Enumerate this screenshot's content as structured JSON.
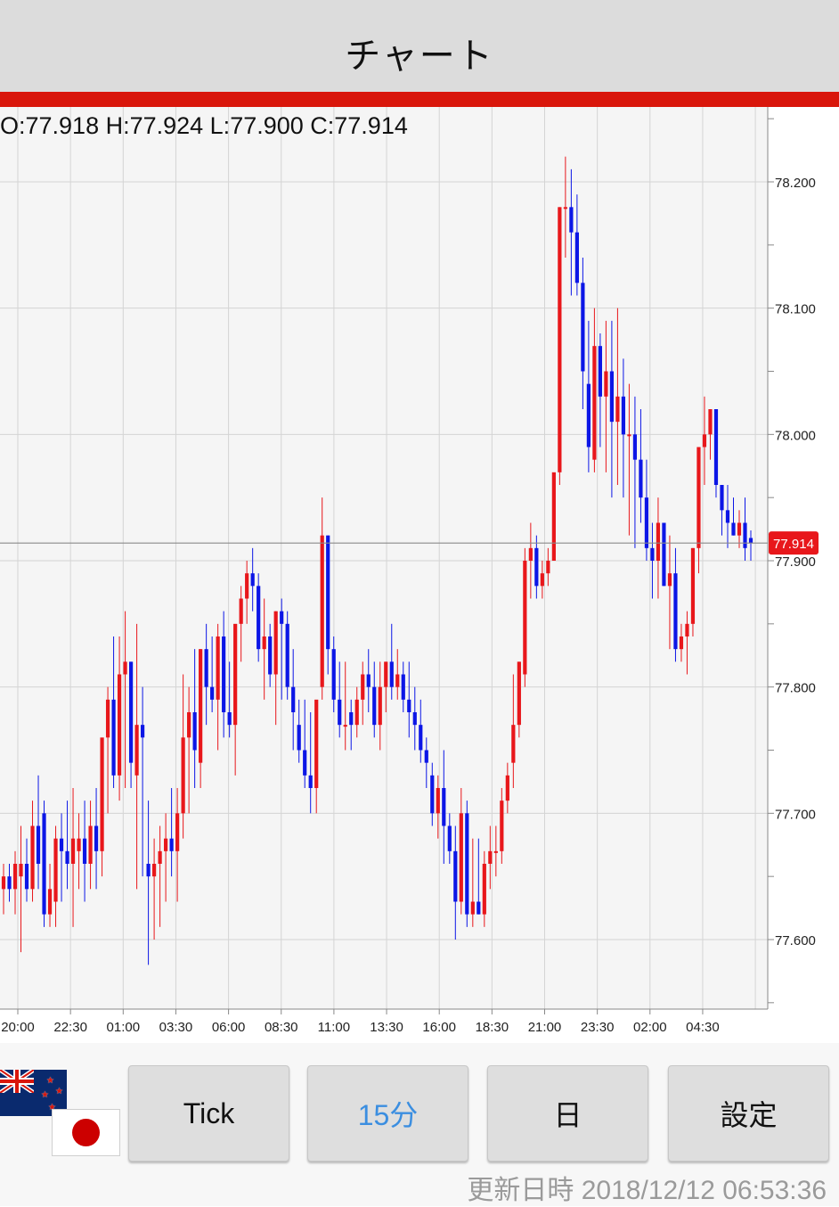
{
  "header": {
    "title": "チャート"
  },
  "ohlc": {
    "text": "O:77.918 H:77.924 L:77.900 C:77.914"
  },
  "chart_data": {
    "type": "candlestick",
    "y_axis_labels": [
      "78.200",
      "78.100",
      "78.000",
      "77.900",
      "77.800",
      "77.700",
      "77.600"
    ],
    "y_axis_values": [
      78.2,
      78.1,
      78.0,
      77.9,
      77.8,
      77.7,
      77.6
    ],
    "x_axis_labels": [
      "20:00",
      "22:30",
      "01:00",
      "03:30",
      "06:00",
      "08:30",
      "11:00",
      "13:30",
      "16:00",
      "18:30",
      "21:00",
      "23:30",
      "02:00",
      "04:30"
    ],
    "ylim": [
      77.54,
      78.25
    ],
    "current_price": 77.914,
    "current_price_label": "77.914",
    "up_color": "#e8171b",
    "down_color": "#0c16e6",
    "grid": true,
    "candles": [
      [
        77.64,
        77.66,
        77.62,
        77.65
      ],
      [
        77.65,
        77.66,
        77.63,
        77.64
      ],
      [
        77.64,
        77.67,
        77.62,
        77.66
      ],
      [
        77.65,
        77.69,
        77.59,
        77.66
      ],
      [
        77.66,
        77.68,
        77.63,
        77.64
      ],
      [
        77.64,
        77.71,
        77.63,
        77.69
      ],
      [
        77.69,
        77.73,
        77.64,
        77.66
      ],
      [
        77.7,
        77.71,
        77.61,
        77.62
      ],
      [
        77.62,
        77.66,
        77.61,
        77.64
      ],
      [
        77.63,
        77.69,
        77.61,
        77.68
      ],
      [
        77.68,
        77.7,
        77.63,
        77.67
      ],
      [
        77.67,
        77.71,
        77.64,
        77.66
      ],
      [
        77.66,
        77.72,
        77.61,
        77.68
      ],
      [
        77.67,
        77.7,
        77.64,
        77.68
      ],
      [
        77.68,
        77.71,
        77.63,
        77.66
      ],
      [
        77.66,
        77.71,
        77.64,
        77.69
      ],
      [
        77.69,
        77.72,
        77.64,
        77.67
      ],
      [
        77.67,
        77.75,
        77.65,
        77.76
      ],
      [
        77.76,
        77.8,
        77.7,
        77.79
      ],
      [
        77.79,
        77.84,
        77.72,
        77.73
      ],
      [
        77.73,
        77.84,
        77.71,
        77.81
      ],
      [
        77.81,
        77.86,
        77.72,
        77.82
      ],
      [
        77.82,
        77.82,
        77.72,
        77.74
      ],
      [
        77.73,
        77.85,
        77.64,
        77.77
      ],
      [
        77.77,
        77.8,
        77.65,
        77.76
      ],
      [
        77.66,
        77.71,
        77.58,
        77.65
      ],
      [
        77.65,
        77.68,
        77.6,
        77.66
      ],
      [
        77.66,
        77.69,
        77.61,
        77.67
      ],
      [
        77.67,
        77.7,
        77.63,
        77.68
      ],
      [
        77.68,
        77.72,
        77.65,
        77.67
      ],
      [
        77.67,
        77.72,
        77.63,
        77.7
      ],
      [
        77.7,
        77.81,
        77.68,
        77.76
      ],
      [
        77.76,
        77.8,
        77.7,
        77.78
      ],
      [
        77.78,
        77.83,
        77.72,
        77.75
      ],
      [
        77.74,
        77.83,
        77.72,
        77.83
      ],
      [
        77.83,
        77.85,
        77.77,
        77.8
      ],
      [
        77.8,
        77.84,
        77.78,
        77.79
      ],
      [
        77.79,
        77.85,
        77.75,
        77.84
      ],
      [
        77.84,
        77.86,
        77.76,
        77.78
      ],
      [
        77.78,
        77.82,
        77.76,
        77.77
      ],
      [
        77.77,
        77.84,
        77.73,
        77.85
      ],
      [
        77.85,
        77.88,
        77.82,
        77.87
      ],
      [
        77.87,
        77.9,
        77.85,
        77.89
      ],
      [
        77.89,
        77.91,
        77.86,
        77.88
      ],
      [
        77.88,
        77.89,
        77.82,
        77.83
      ],
      [
        77.83,
        77.87,
        77.79,
        77.84
      ],
      [
        77.84,
        77.85,
        77.8,
        77.81
      ],
      [
        77.81,
        77.86,
        77.77,
        77.86
      ],
      [
        77.86,
        77.87,
        77.79,
        77.85
      ],
      [
        77.85,
        77.86,
        77.79,
        77.8
      ],
      [
        77.8,
        77.83,
        77.75,
        77.78
      ],
      [
        77.77,
        77.79,
        77.74,
        77.75
      ],
      [
        77.75,
        77.79,
        77.72,
        77.73
      ],
      [
        77.73,
        77.78,
        77.7,
        77.72
      ],
      [
        77.72,
        77.76,
        77.7,
        77.79
      ],
      [
        77.8,
        77.95,
        77.79,
        77.92
      ],
      [
        77.92,
        77.92,
        77.81,
        77.83
      ],
      [
        77.83,
        77.84,
        77.78,
        77.79
      ],
      [
        77.79,
        77.82,
        77.76,
        77.77
      ],
      [
        77.77,
        77.82,
        77.75,
        77.77
      ],
      [
        77.78,
        77.79,
        77.75,
        77.77
      ],
      [
        77.77,
        77.8,
        77.76,
        77.79
      ],
      [
        77.79,
        77.82,
        77.77,
        77.81
      ],
      [
        77.81,
        77.83,
        77.78,
        77.8
      ],
      [
        77.8,
        77.82,
        77.76,
        77.77
      ],
      [
        77.77,
        77.82,
        77.75,
        77.8
      ],
      [
        77.8,
        77.82,
        77.78,
        77.82
      ],
      [
        77.82,
        77.85,
        77.79,
        77.8
      ],
      [
        77.8,
        77.83,
        77.79,
        77.81
      ],
      [
        77.81,
        77.82,
        77.78,
        77.79
      ],
      [
        77.79,
        77.82,
        77.76,
        77.78
      ],
      [
        77.78,
        77.8,
        77.75,
        77.77
      ],
      [
        77.77,
        77.79,
        77.74,
        77.75
      ],
      [
        77.75,
        77.76,
        77.72,
        77.74
      ],
      [
        77.73,
        77.74,
        77.69,
        77.7
      ],
      [
        77.7,
        77.73,
        77.68,
        77.72
      ],
      [
        77.72,
        77.75,
        77.66,
        77.69
      ],
      [
        77.69,
        77.7,
        77.66,
        77.67
      ],
      [
        77.67,
        77.69,
        77.6,
        77.63
      ],
      [
        77.63,
        77.72,
        77.62,
        77.7
      ],
      [
        77.7,
        77.71,
        77.61,
        77.62
      ],
      [
        77.62,
        77.68,
        77.61,
        77.63
      ],
      [
        77.63,
        77.68,
        77.62,
        77.62
      ],
      [
        77.62,
        77.67,
        77.61,
        77.66
      ],
      [
        77.66,
        77.69,
        77.64,
        77.67
      ],
      [
        77.67,
        77.69,
        77.65,
        77.67
      ],
      [
        77.67,
        77.72,
        77.66,
        77.71
      ],
      [
        77.71,
        77.74,
        77.7,
        77.73
      ],
      [
        77.74,
        77.81,
        77.72,
        77.77
      ],
      [
        77.77,
        77.82,
        77.76,
        77.82
      ],
      [
        77.81,
        77.91,
        77.8,
        77.9
      ],
      [
        77.9,
        77.93,
        77.87,
        77.91
      ],
      [
        77.91,
        77.92,
        77.87,
        77.88
      ],
      [
        77.88,
        77.9,
        77.87,
        77.89
      ],
      [
        77.89,
        77.91,
        77.88,
        77.9
      ],
      [
        77.9,
        77.95,
        77.9,
        77.97
      ],
      [
        77.97,
        78.18,
        77.96,
        78.18
      ],
      [
        78.18,
        78.22,
        78.14,
        78.18
      ],
      [
        78.18,
        78.21,
        78.11,
        78.16
      ],
      [
        78.16,
        78.19,
        78.11,
        78.12
      ],
      [
        78.12,
        78.14,
        78.02,
        78.05
      ],
      [
        78.04,
        78.09,
        77.97,
        77.99
      ],
      [
        77.98,
        78.1,
        77.97,
        78.07
      ],
      [
        78.07,
        78.08,
        77.99,
        78.03
      ],
      [
        78.03,
        78.09,
        77.97,
        78.05
      ],
      [
        78.05,
        78.09,
        77.95,
        78.01
      ],
      [
        78.01,
        78.1,
        77.96,
        78.03
      ],
      [
        78.03,
        78.06,
        77.95,
        78.0
      ],
      [
        78.0,
        78.04,
        77.92,
        78.0
      ],
      [
        78.0,
        78.03,
        77.91,
        77.98
      ],
      [
        77.98,
        78.02,
        77.93,
        77.95
      ],
      [
        77.95,
        77.98,
        77.9,
        77.91
      ],
      [
        77.91,
        77.93,
        77.87,
        77.9
      ],
      [
        77.9,
        77.95,
        77.87,
        77.93
      ],
      [
        77.93,
        77.93,
        77.88,
        77.88
      ],
      [
        77.88,
        77.92,
        77.83,
        77.89
      ],
      [
        77.89,
        77.91,
        77.82,
        77.83
      ],
      [
        77.83,
        77.85,
        77.82,
        77.84
      ],
      [
        77.84,
        77.86,
        77.81,
        77.85
      ],
      [
        77.85,
        77.91,
        77.84,
        77.91
      ],
      [
        77.91,
        77.99,
        77.89,
        77.99
      ],
      [
        77.99,
        78.03,
        77.96,
        78.0
      ],
      [
        78.0,
        78.02,
        77.98,
        78.02
      ],
      [
        78.02,
        78.02,
        77.95,
        77.96
      ],
      [
        77.96,
        77.96,
        77.92,
        77.94
      ],
      [
        77.94,
        77.96,
        77.91,
        77.93
      ],
      [
        77.93,
        77.95,
        77.92,
        77.92
      ],
      [
        77.92,
        77.94,
        77.91,
        77.93
      ],
      [
        77.93,
        77.95,
        77.9,
        77.91
      ],
      [
        77.918,
        77.924,
        77.9,
        77.914
      ]
    ]
  },
  "buttons": [
    {
      "label": "Tick",
      "active": false
    },
    {
      "label": "15分",
      "active": true
    },
    {
      "label": "日",
      "active": false
    },
    {
      "label": "設定",
      "active": false
    }
  ],
  "footer": {
    "updated_text": "更新日時  2018/12/12 06:53:36"
  }
}
